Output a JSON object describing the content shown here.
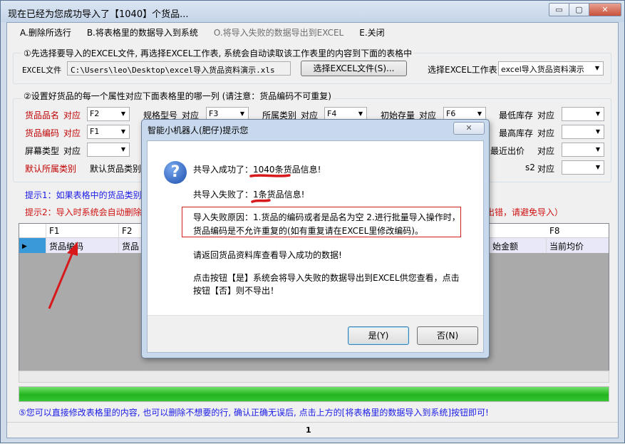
{
  "window": {
    "title": "现在已经为您成功导入了【1040】个货品...",
    "minimize": "▭",
    "maximize": "▢",
    "close": "✕"
  },
  "menu": {
    "items": [
      {
        "label": "A.删除所选行",
        "enabled": true
      },
      {
        "label": "B.将表格里的数据导入到系统",
        "enabled": true
      },
      {
        "label": "O.将导入失败的数据导出到EXCEL",
        "enabled": false
      },
      {
        "label": "E.关闭",
        "enabled": true
      }
    ]
  },
  "step1": {
    "title": "①先选择要导入的EXCEL文件, 再选择EXCEL工作表, 系统会自动读取该工作表里的内容到下面的表格中",
    "file_label": "EXCEL文件",
    "file_path": "C:\\Users\\leo\\Desktop\\excel导入货品资料演示.xls",
    "choose_button": "选择EXCEL文件(S)...",
    "sheet_label": "选择EXCEL工作表",
    "sheet_value": "excel导入货品资料演示"
  },
  "step2": {
    "title": "②设置好货品的每一个属性对应下面表格里的哪一列 (请注意：货品编码不可重复)",
    "fields": {
      "name_label": "货品品名",
      "name_map": "对应",
      "name_value": "F2",
      "spec_label": "规格型号",
      "spec_map": "对应",
      "spec_value": "F3",
      "category_label": "所属类别",
      "category_map": "对应",
      "category_value": "F4",
      "init_stock_label": "初始存量",
      "init_stock_map": "对应",
      "init_stock_value": "F6",
      "min_stock_label": "最低库存",
      "min_stock_map": "对应",
      "code_label": "货品编码",
      "code_map": "对应",
      "code_value": "F1",
      "max_stock_label": "最高库存",
      "max_stock_map": "对应",
      "screen_label": "屏幕类型",
      "screen_map": "对应",
      "last_price_label": "最近出价",
      "last_price_map": "对应",
      "default_cat_label": "默认所属类别",
      "default_cat_value": "默认货品类别",
      "s2_label": "s2",
      "s2_map": "对应"
    }
  },
  "tips": {
    "tip1": "提示1：如果表格中的货品类别",
    "tip2": "提示2：导入时系统会自动删除",
    "tip2_tail": "出错，请避免导入）"
  },
  "grid": {
    "columns": [
      "F1",
      "F2",
      "F8"
    ],
    "row": {
      "c1": "货品编码",
      "c2": "货品",
      "c7": "始金额",
      "c8": "当前均价"
    }
  },
  "bottom_tip": "⑤您可以直接修改表格里的内容, 也可以删除不想要的行, 确认正确无误后, 点击上方的[将表格里的数据导入到系统]按钮即可!",
  "status": {
    "page": "1"
  },
  "dialog": {
    "title": "智能小机器人(肥仔)提示您",
    "close": "✕",
    "icon": "question-icon",
    "success_prefix": "共导入成功了：",
    "success_count": "1040",
    "success_suffix": "条货品信息!",
    "fail_prefix": "共导入失败了：",
    "fail_count": "1",
    "fail_suffix": "条货品信息!",
    "reason_line1": "导入失败原因：1.货品的编码或者是品名为空 2.进行批量导入操作时，",
    "reason_line2": "货品编码是不允许重复的(如有重复请在EXCEL里修改编码)。",
    "return_msg": "请返回货品资料库查看导入成功的数据!",
    "hint_line1": "点击按钮【是】系统会将导入失败的数据导出到EXCEL供您查看，点击",
    "hint_line2": "按钮【否】则不导出！",
    "yes_button": "是(Y)",
    "no_button": "否(N)"
  },
  "annotation_color": "#d8191b"
}
